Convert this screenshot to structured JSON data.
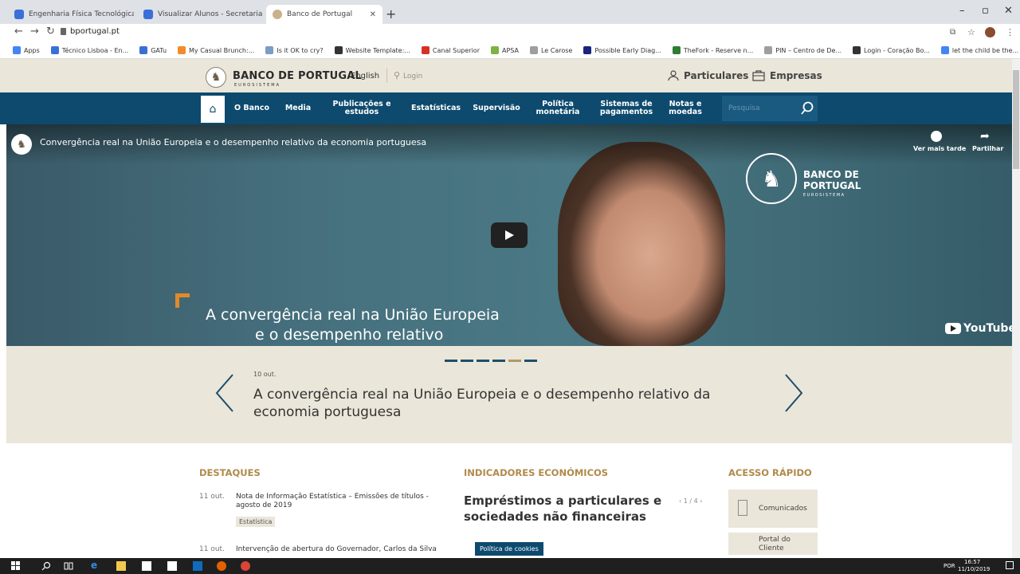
{
  "browser": {
    "tabs": [
      {
        "title": "Engenharia Física Tecnológica – T",
        "active": false
      },
      {
        "title": "Visualizar Alunos - Secretaria Aca",
        "active": false
      },
      {
        "title": "Banco de Portugal",
        "active": true
      }
    ],
    "url": "bportugal.pt",
    "bookmarks": [
      {
        "label": "Apps",
        "color": "#4285f4"
      },
      {
        "label": "Técnico Lisboa - En...",
        "color": "#3b6fd8"
      },
      {
        "label": "GATu",
        "color": "#3b6fd8"
      },
      {
        "label": "My Casual Brunch:...",
        "color": "#f28c28"
      },
      {
        "label": "Is it OK to cry?",
        "color": "#7a9cc6"
      },
      {
        "label": "Website Template:...",
        "color": "#333333"
      },
      {
        "label": "Canal Superior",
        "color": "#d93025"
      },
      {
        "label": "APSA",
        "color": "#7cb342"
      },
      {
        "label": "Le Carose",
        "color": "#9e9e9e"
      },
      {
        "label": "Possible Early Diag...",
        "color": "#1a237e"
      },
      {
        "label": "TheFork - Reserve n...",
        "color": "#2e7d32"
      },
      {
        "label": "PIN – Centro de De...",
        "color": "#9e9e9e"
      },
      {
        "label": "Login - Coração Bo...",
        "color": "#333333"
      },
      {
        "label": "let the child be the...",
        "color": "#4285f4"
      }
    ]
  },
  "header": {
    "logo_main": "BANCO DE PORTUGAL",
    "logo_sub": "EUROSISTEMA",
    "lang": "English",
    "login": "Login",
    "particulares": "Particulares",
    "empresas": "Empresas"
  },
  "nav": {
    "items": [
      {
        "label": "O Banco"
      },
      {
        "label": "Media"
      },
      {
        "label": "Publicações e estudos"
      },
      {
        "label": "Estatísticas"
      },
      {
        "label": "Supervisão"
      },
      {
        "label": "Política monetária"
      },
      {
        "label": "Sistemas de pagamentos"
      },
      {
        "label": "Notas e moedas"
      }
    ],
    "search_placeholder": "Pesquisa"
  },
  "video": {
    "title": "Convergência real na União Europeia e o desempenho relativo da economia portuguesa",
    "watch_later": "Ver mais tarde",
    "share": "Partilhar",
    "brand_line1": "BANCO DE",
    "brand_line2": "PORTUGAL",
    "brand_line3": "EUROSISTEMA",
    "caption_line1": "A convergência real na União Europeia",
    "caption_line2": "e o desempenho relativo",
    "youtube": "YouTube"
  },
  "carousel": {
    "slide_count": 6,
    "active_slide": 5,
    "date": "10 out.",
    "title": "A convergência real na União Europeia e o desempenho relativo da economia portuguesa"
  },
  "destaques": {
    "heading": "DESTAQUES",
    "items": [
      {
        "date": "11 out.",
        "text": "Nota de Informação Estatística – Emissões de títulos - agosto de 2019",
        "tag": "Estatística"
      },
      {
        "date": "11 out.",
        "text": "Intervenção de abertura do Governador, Carlos da Silva"
      }
    ]
  },
  "indicadores": {
    "heading": "INDICADORES ECONÓMICOS",
    "title": "Empréstimos a particulares e sociedades não financeiras",
    "pager": "‹ 1 / 4 ›"
  },
  "acesso": {
    "heading": "ACESSO RÁPIDO",
    "items": [
      {
        "label": "Comunicados"
      },
      {
        "label": "Portal do Cliente"
      }
    ]
  },
  "cookie": "Política de cookies",
  "taskbar": {
    "lang": "POR",
    "time": "16:57",
    "date": "11/10/2019"
  }
}
